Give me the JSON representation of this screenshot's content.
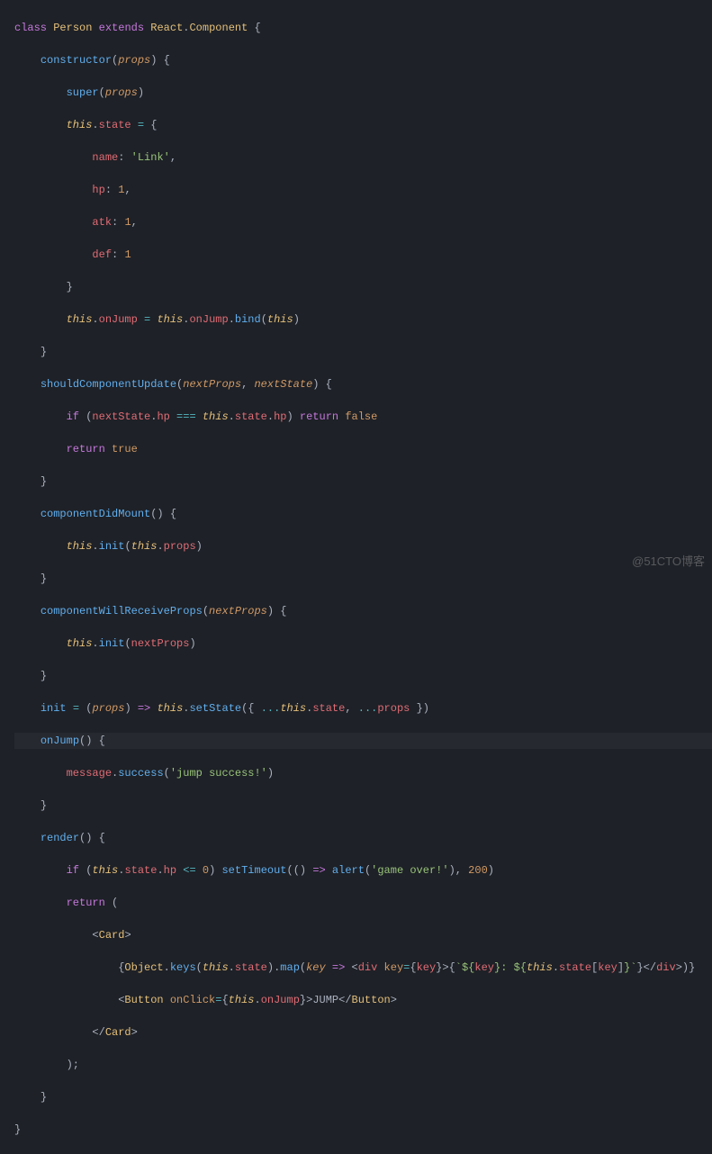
{
  "code": {
    "class_name": "Person",
    "extends": "React.Component",
    "constructor": {
      "param": "props",
      "super_call": "super",
      "state_props": {
        "name": {
          "key": "name",
          "value": "'Link'"
        },
        "hp": {
          "key": "hp",
          "value": "1"
        },
        "atk": {
          "key": "atk",
          "value": "1"
        },
        "def": {
          "key": "def",
          "value": "1"
        }
      },
      "bind_method": "onJump",
      "bind_func": "bind"
    },
    "shouldComponentUpdate": {
      "name": "shouldComponentUpdate",
      "params": "nextProps, nextState",
      "p1": "nextProps",
      "p2": "nextState",
      "if_cond_left": "nextState",
      "if_cond_prop": "hp",
      "if_cond_right_prop": "hp",
      "return_false": "false",
      "return_true": "true"
    },
    "componentDidMount": {
      "name": "componentDidMount",
      "call": "init",
      "arg": "props"
    },
    "componentWillReceiveProps": {
      "name": "componentWillReceiveProps",
      "param": "nextProps",
      "call": "init"
    },
    "init": {
      "name": "init",
      "param": "props",
      "setState": "setState"
    },
    "onJump": {
      "name": "onJump",
      "msg_obj": "message",
      "msg_fn": "success",
      "msg_text": "'jump success!'"
    },
    "render": {
      "name": "render",
      "if_prop": "hp",
      "setTimeout": "setTimeout",
      "alert": "alert",
      "alert_text": "'game over!'",
      "timeout_val": "200",
      "card_tag": "Card",
      "object_keys": "Object",
      "keys_fn": "keys",
      "map_fn": "map",
      "map_param": "key",
      "div_tag": "div",
      "key_attr": "key",
      "button_tag": "Button",
      "onClick_attr": "onClick",
      "button_text": "JUMP"
    },
    "keywords": {
      "class": "class",
      "extends": "extends",
      "constructor": "constructor",
      "this": "this",
      "state": "state",
      "if": "if",
      "return": "return",
      "props": "props"
    }
  },
  "watermark": "@51CTO博客"
}
